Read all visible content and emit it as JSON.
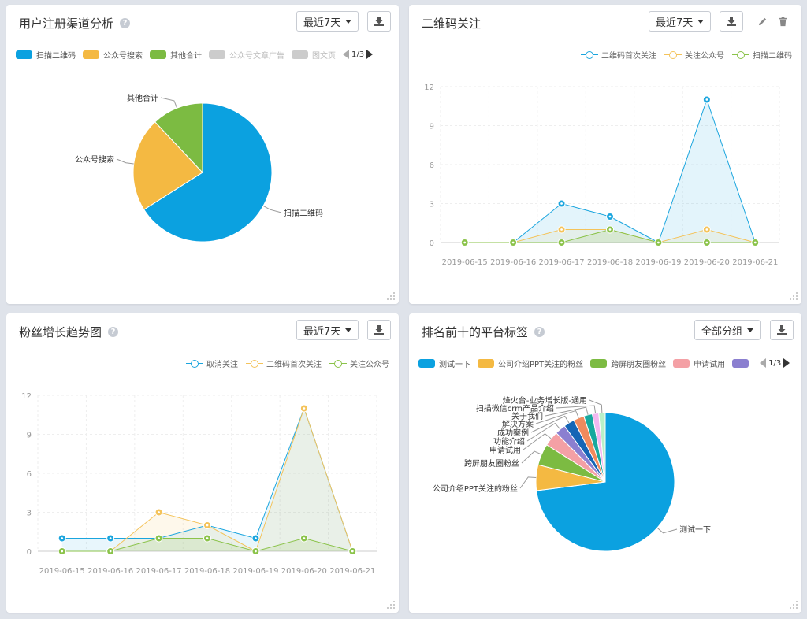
{
  "panels": [
    {
      "title": "用户注册渠道分析",
      "range_label": "最近7天",
      "legend": [
        {
          "name": "扫描二维码",
          "color": "#0ba1e0",
          "dim": false
        },
        {
          "name": "公众号搜索",
          "color": "#f4b942",
          "dim": false
        },
        {
          "name": "其他合计",
          "color": "#7cbb42",
          "dim": false
        },
        {
          "name": "公众号文章广告",
          "color": "#cccccc",
          "dim": true
        },
        {
          "name": "图文页",
          "color": "#cccccc",
          "dim": true
        }
      ],
      "pager": "1/3"
    },
    {
      "title": "二维码关注",
      "range_label": "最近7天",
      "legend": [
        {
          "name": "二维码首次关注",
          "color": "#1aa5de"
        },
        {
          "name": "关注公众号",
          "color": "#f4c35a"
        },
        {
          "name": "扫描二维码",
          "color": "#8bc34a"
        }
      ]
    },
    {
      "title": "粉丝增长趋势图",
      "range_label": "最近7天",
      "legend": [
        {
          "name": "取消关注",
          "color": "#1aa5de"
        },
        {
          "name": "二维码首次关注",
          "color": "#f4c35a"
        },
        {
          "name": "关注公众号",
          "color": "#8bc34a"
        }
      ]
    },
    {
      "title": "排名前十的平台标签",
      "range_label": "全部分组",
      "legend": [
        {
          "name": "测试一下",
          "color": "#0ba1e0"
        },
        {
          "name": "公司介绍PPT关注的粉丝",
          "color": "#f4b942"
        },
        {
          "name": "跨屏朋友圈粉丝",
          "color": "#7cbb42"
        },
        {
          "name": "申请试用",
          "color": "#f4a0a5"
        },
        {
          "name": "",
          "color": "#8b7fd0"
        }
      ],
      "pager": "1/3"
    }
  ],
  "chart_data": [
    {
      "type": "pie",
      "title": "用户注册渠道分析",
      "labels": [
        "扫描二维码",
        "公众号搜索",
        "其他合计"
      ],
      "values": [
        66,
        22,
        12
      ],
      "colors": [
        "#0ba1e0",
        "#f4b942",
        "#7cbb42"
      ]
    },
    {
      "type": "line",
      "title": "二维码关注",
      "x": [
        "2019-06-15",
        "2019-06-16",
        "2019-06-17",
        "2019-06-18",
        "2019-06-19",
        "2019-06-20",
        "2019-06-21"
      ],
      "yticks": [
        "0",
        "3",
        "6",
        "9",
        "12"
      ],
      "ylim": [
        0,
        12
      ],
      "series": [
        {
          "name": "二维码首次关注",
          "values": [
            0,
            0,
            3,
            2,
            0,
            11,
            0
          ],
          "color": "#1aa5de",
          "fill": "rgba(26,165,222,0.12)"
        },
        {
          "name": "关注公众号",
          "values": [
            0,
            0,
            1,
            1,
            0,
            1,
            0
          ],
          "color": "#f4c35a",
          "fill": "rgba(244,195,90,0.10)"
        },
        {
          "name": "扫描二维码",
          "values": [
            0,
            0,
            0,
            1,
            0,
            0,
            0
          ],
          "color": "#8bc34a",
          "fill": "rgba(139,195,74,0.15)"
        }
      ]
    },
    {
      "type": "line",
      "title": "粉丝增长趋势图",
      "x": [
        "2019-06-15",
        "2019-06-16",
        "2019-06-17",
        "2019-06-18",
        "2019-06-19",
        "2019-06-20",
        "2019-06-21"
      ],
      "yticks": [
        "0",
        "3",
        "6",
        "9",
        "12"
      ],
      "ylim": [
        0,
        12
      ],
      "series": [
        {
          "name": "取消关注",
          "values": [
            1,
            1,
            1,
            2,
            1,
            11,
            0
          ],
          "color": "#1aa5de",
          "fill": "rgba(26,165,222,0.10)"
        },
        {
          "name": "二维码首次关注",
          "values": [
            0,
            0,
            3,
            2,
            0,
            11,
            0
          ],
          "color": "#f4c35a",
          "fill": "rgba(244,195,90,0.12)"
        },
        {
          "name": "关注公众号",
          "values": [
            0,
            0,
            1,
            1,
            0,
            1,
            0
          ],
          "color": "#8bc34a",
          "fill": "rgba(139,195,74,0.15)"
        }
      ]
    },
    {
      "type": "pie",
      "title": "排名前十的平台标签",
      "labels": [
        "测试一下",
        "公司介绍PPT关注的粉丝",
        "跨屏朋友圈粉丝",
        "申请试用",
        "功能介绍",
        "成功案例",
        "解决方案",
        "关于我们",
        "扫描微信crm产品介绍",
        "烽火台-业务增长版-通用"
      ],
      "values": [
        73,
        6,
        5,
        3.5,
        2.5,
        2.5,
        2.5,
        2,
        1.5,
        1.5
      ],
      "colors": [
        "#0ba1e0",
        "#f4b942",
        "#7cbb42",
        "#f4a0a5",
        "#8b7fd0",
        "#1565b5",
        "#f08a5d",
        "#17a89e",
        "#f3b8f0",
        "#b8f0c8"
      ]
    }
  ]
}
